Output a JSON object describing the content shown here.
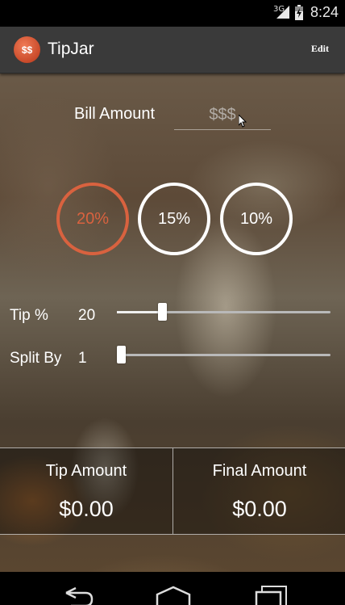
{
  "status_bar": {
    "network": "3G",
    "time": "8:24"
  },
  "app_bar": {
    "icon_label": "$$",
    "title": "TipJar",
    "edit_label": "Edit"
  },
  "bill": {
    "label": "Bill Amount",
    "placeholder": "$$$"
  },
  "presets": [
    {
      "label": "20%",
      "selected": true
    },
    {
      "label": "15%",
      "selected": false
    },
    {
      "label": "10%",
      "selected": false
    }
  ],
  "tip": {
    "label": "Tip %",
    "value": "20",
    "slider_fraction": 0.2
  },
  "split": {
    "label": "Split By",
    "value": "1",
    "slider_fraction": 0.0
  },
  "results": {
    "tip_title": "Tip Amount",
    "tip_value": "$0.00",
    "final_title": "Final Amount",
    "final_value": "$0.00"
  },
  "colors": {
    "accent": "#d9623f",
    "action_bar": "#3a3a3a"
  },
  "icons": {
    "nav": [
      "back-icon",
      "home-icon",
      "recent-apps-icon"
    ]
  }
}
